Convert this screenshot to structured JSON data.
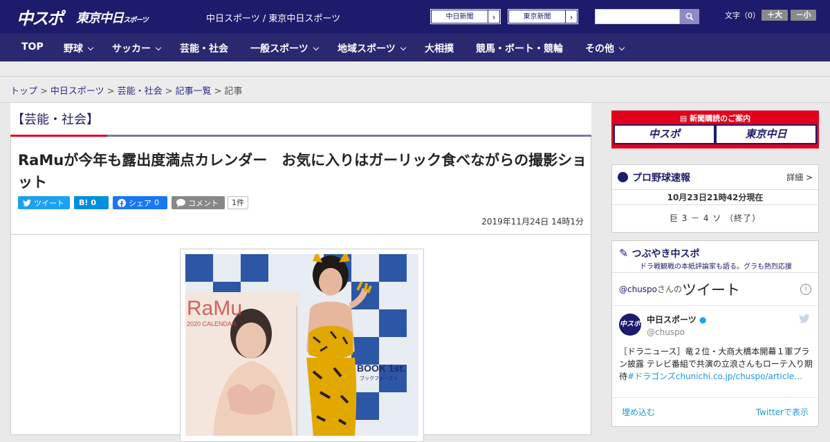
{
  "header": {
    "logo_chuspo": "中スポ",
    "logo_tokyo": "東京中日",
    "logo_tokyo_sub": "スポーツ",
    "site_name": "中日スポーツ / 東京中日スポーツ",
    "paper_links": [
      {
        "label": "中日新聞",
        "arrow": "›"
      },
      {
        "label": "東京新聞",
        "arrow": "›"
      }
    ],
    "search_placeholder": "",
    "font_size_label": "文字（0）",
    "font_larger": "＋大",
    "font_smaller": "－小"
  },
  "nav": {
    "items": [
      {
        "label": "TOP",
        "dropdown": false
      },
      {
        "label": "野球",
        "dropdown": true
      },
      {
        "label": "サッカー",
        "dropdown": true
      },
      {
        "label": "芸能・社会",
        "dropdown": false
      },
      {
        "label": "一般スポーツ",
        "dropdown": true
      },
      {
        "label": "地域スポーツ",
        "dropdown": true
      },
      {
        "label": "大相撲",
        "dropdown": false
      },
      {
        "label": "競馬・ボート・競輪",
        "dropdown": false
      },
      {
        "label": "その他",
        "dropdown": true
      }
    ]
  },
  "breadcrumb": {
    "items": [
      "トップ",
      "中日スポーツ",
      "芸能・社会",
      "記事一覧",
      "記事"
    ],
    "separator": ">"
  },
  "article": {
    "category": "【芸能・社会】",
    "title": "RaMuが今年も露出度満点カレンダー　お気に入りはガーリック食べながらの撮影ショット",
    "share": {
      "tweet": "ツイート",
      "hatena_count": "0",
      "facebook": "シェア",
      "facebook_count": "0",
      "comment": "コメント",
      "comment_count": "1件"
    },
    "date": "2019年11月24日 14時1分",
    "photo": {
      "calendar_name": "RaMu",
      "calendar_sub": "2020 CALENDAR",
      "backdrop_text": "BOOK 1st.",
      "backdrop_sub": "ブックファースト"
    }
  },
  "sidebar": {
    "subscribe": {
      "heading": "新聞購読のご案内",
      "logos": [
        "中スポ",
        "東京中日"
      ]
    },
    "baseball": {
      "title": "プロ野球速報",
      "more": "詳細 >",
      "time": "10月23日21時42分現在",
      "game": "巨 3 － 4 ソ （終了）"
    },
    "tweets": {
      "title": "つぶやき中スポ",
      "subtitle": "ドラ戦観戦の本紙評論家も語る。グラも熱烈応援",
      "handle_link": "@chuspo",
      "san_no": "さんの",
      "tweet_word": "ツイート",
      "user_name": "中日スポーツ",
      "user_handle": "@chuspo",
      "avatar_text": "中スポ",
      "text": "［ドラニュース］竜２位・大商大橋本開幕１軍プラン披露 テレビ番組で共演の立浪さんもローテ入り期待",
      "hashtag": "#ドラゴンズ",
      "link": "chunichi.co.jp/chuspo/article…",
      "embed": "埋め込む",
      "view_on_twitter": "Twitterで表示"
    }
  },
  "colors": {
    "brand_navy": "#1d1b6b",
    "nav_bg": "#2a286e",
    "accent_red": "#e3001b",
    "twitter_blue": "#1da1f2",
    "hatena_blue": "#008fde",
    "facebook_blue": "#1877f2"
  }
}
